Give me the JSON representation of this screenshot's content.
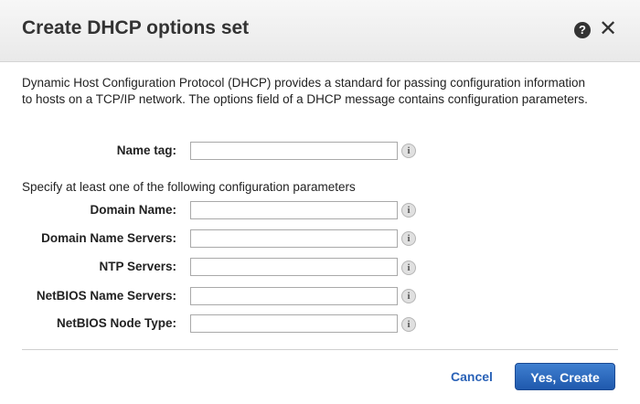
{
  "dialog": {
    "title": "Create DHCP options set",
    "help_icon_glyph": "?",
    "close_icon_glyph": "✕",
    "description": "Dynamic Host Configuration Protocol (DHCP) provides a standard for passing configuration information to hosts on a TCP/IP network. The options field of a DHCP message contains configuration parameters."
  },
  "name_tag": {
    "label": "Name tag:",
    "value": ""
  },
  "instruction": "Specify at least one of the following configuration parameters",
  "fields": [
    {
      "label": "Domain Name:",
      "value": ""
    },
    {
      "label": "Domain Name Servers:",
      "value": ""
    },
    {
      "label": "NTP Servers:",
      "value": ""
    },
    {
      "label": "NetBIOS Name Servers:",
      "value": ""
    },
    {
      "label": "NetBIOS Node Type:",
      "value": ""
    }
  ],
  "info_icon_glyph": "i",
  "footer": {
    "cancel_label": "Cancel",
    "confirm_label": "Yes, Create"
  },
  "colors": {
    "link_blue": "#2a62b7",
    "primary_button": "#2a6ac0"
  }
}
